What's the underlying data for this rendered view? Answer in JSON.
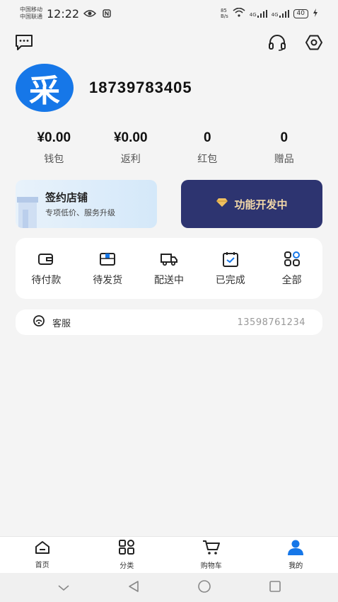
{
  "status_bar": {
    "carrier_1": "中国移动",
    "carrier_2": "中国联通",
    "time": "12:22",
    "net_speed_top": "85",
    "net_speed_unit": "B/s",
    "signal_1": "4G",
    "signal_2": "4G",
    "battery": "40"
  },
  "profile": {
    "avatar_char": "采",
    "phone": "18739783405"
  },
  "stats": [
    {
      "value": "¥0.00",
      "label": "钱包"
    },
    {
      "value": "¥0.00",
      "label": "返利"
    },
    {
      "value": "0",
      "label": "红包"
    },
    {
      "value": "0",
      "label": "赠品"
    }
  ],
  "sign_store": {
    "title": "签约店铺",
    "subtitle": "专项低价、服务升级"
  },
  "dev_card": {
    "label": "功能开发中"
  },
  "orders": [
    {
      "label": "待付款",
      "icon": "wallet-icon"
    },
    {
      "label": "待发货",
      "icon": "package-icon"
    },
    {
      "label": "配送中",
      "icon": "truck-icon"
    },
    {
      "label": "已完成",
      "icon": "calendar-check-icon"
    },
    {
      "label": "全部",
      "icon": "grid-icon"
    }
  ],
  "service": {
    "label": "客服",
    "phone": "13598761234"
  },
  "tabbar": [
    {
      "label": "首页",
      "icon": "home-icon"
    },
    {
      "label": "分类",
      "icon": "category-icon"
    },
    {
      "label": "购物车",
      "icon": "cart-icon"
    },
    {
      "label": "我的",
      "icon": "user-icon",
      "active": true
    }
  ],
  "colors": {
    "accent": "#1677e8",
    "dev_card_bg": "#2d3470",
    "dev_card_text": "#f2d8a8"
  }
}
